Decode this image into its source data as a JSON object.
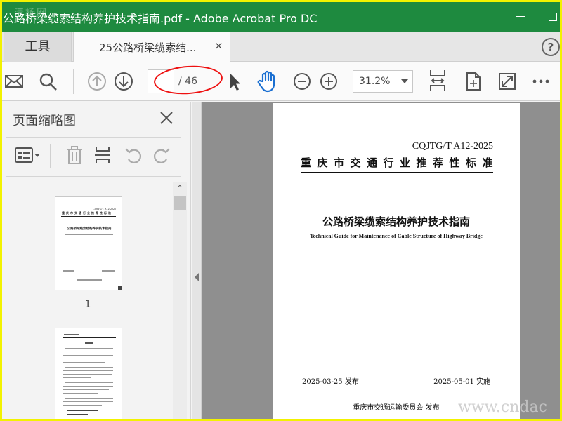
{
  "window": {
    "title": "公路桥梁缆索结构养护技术指南.pdf - Adobe Acrobat Pro DC",
    "watermark": "清杨网"
  },
  "tabs": {
    "tools_label": "工具",
    "document_label": "25公路桥梁缆索结...",
    "close": "×",
    "help": "?"
  },
  "toolbar": {
    "current_page": "",
    "page_total": "/ 46",
    "zoom": "31.2%",
    "icons": [
      "mail-icon",
      "search-icon",
      "page-up-icon",
      "page-down-icon",
      "select-cursor-icon",
      "hand-icon",
      "zoom-out-icon",
      "zoom-in-icon",
      "fit-page-icon",
      "page-rotate-icon",
      "fullscreen-icon",
      "more-icon"
    ]
  },
  "thumbnails_panel": {
    "title": "页面缩略图",
    "thumb1_label": "1",
    "thumb1_code": "CQJTG/T A12-2025",
    "thumb1_cat": "重庆市交通行业推荐性标准",
    "thumb1_title": "公路桥梁缆索结构养护技术指南"
  },
  "document": {
    "standard_code": "CQJTG/T A12-2025",
    "standard_category": "重庆市交通行业推荐性标准",
    "title_cn": "公路桥梁缆索结构养护技术指南",
    "title_en": "Technical Guide for Maintenance of Cable Structure of Highway Bridge",
    "publish_date": "2025-03-25 发布",
    "effective_date": "2025-05-01 实施",
    "issuer": "重庆市交通运输委员会    发布"
  },
  "bottom_watermark": "www.cndac",
  "colors": {
    "titlebar": "#1e8a3f",
    "frame": "#f2f200",
    "annotation": "#e11111",
    "hand_icon": "#1a6fd1"
  }
}
